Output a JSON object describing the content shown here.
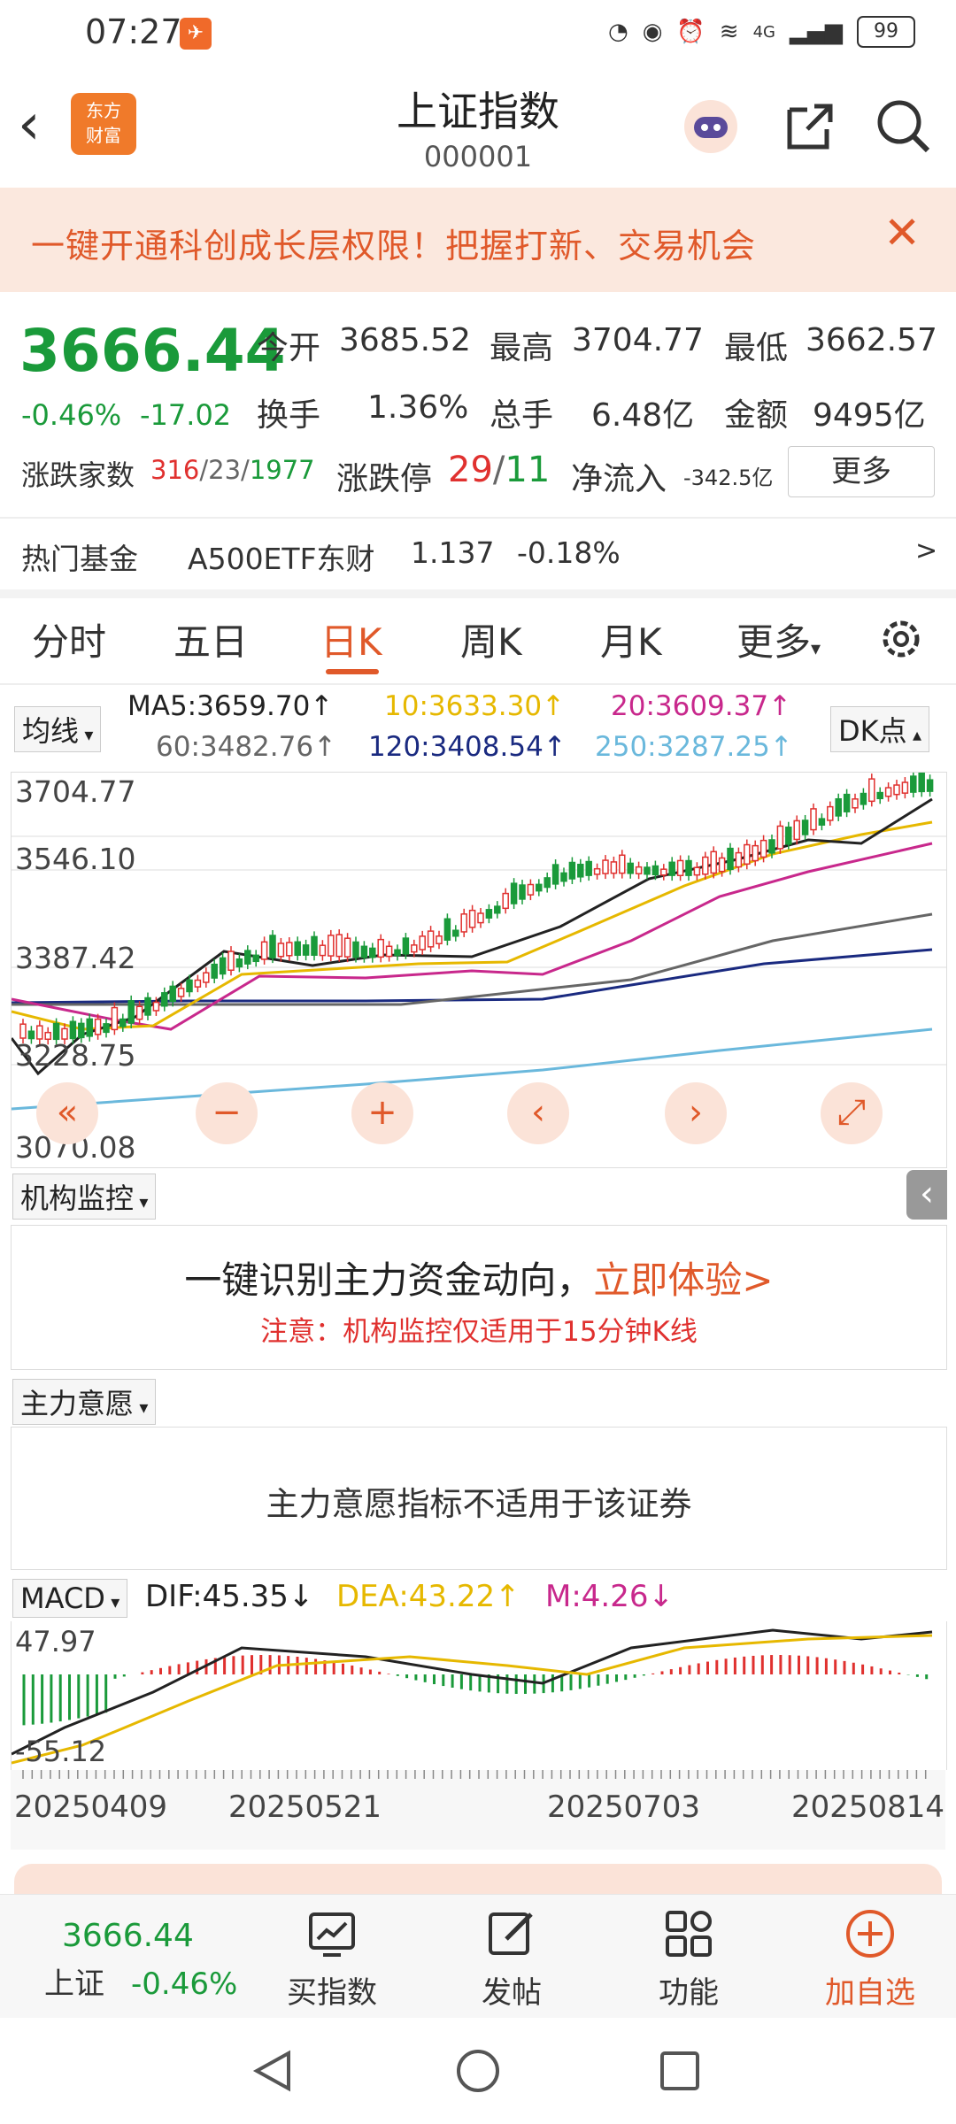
{
  "status": {
    "time": "07:27",
    "network": "4G",
    "battery": "99"
  },
  "header": {
    "title": "上证指数",
    "code": "000001",
    "logo_line1": "东方",
    "logo_line2": "财富"
  },
  "banner": {
    "text": "一键开通科创成长层权限！把握打新、交易机会"
  },
  "quote": {
    "price": "3666.44",
    "change_pct": "-0.46%",
    "change": "-17.02",
    "open_label": "今开",
    "open": "3685.52",
    "high_label": "最高",
    "high": "3704.77",
    "low_label": "最低",
    "low": "3662.57",
    "turnover_label": "换手",
    "turnover": "1.36%",
    "volume_label": "总手",
    "volume": "6.48亿",
    "amount_label": "金额",
    "amount": "9495亿",
    "breadth_label": "涨跌家数",
    "breadth_up": "316",
    "breadth_flat": "23",
    "breadth_down": "1977",
    "limit_label": "涨跌停",
    "limit_up": "29",
    "limit_down": "11",
    "inflow_label": "净流入",
    "inflow": "-342.5亿",
    "more": "更多"
  },
  "fund": {
    "label": "热门基金",
    "name": "A500ETF东财",
    "price": "1.137",
    "chg": "-0.18%",
    "arrow": ">"
  },
  "tabs": [
    "分时",
    "五日",
    "日K",
    "周K",
    "月K",
    "更多"
  ],
  "active_tab": 2,
  "ma": {
    "selector": "均线",
    "dk": "DK点",
    "ma5": "MA5:3659.70↑",
    "ma10": "10:3633.30↑",
    "ma20": "20:3609.37↑",
    "ma60": "60:3482.76↑",
    "ma120": "120:3408.54↑",
    "ma250": "250:3287.25↑",
    "colors": {
      "ma5": "#222222",
      "ma10": "#e6b800",
      "ma20": "#c8288c",
      "ma60": "#666666",
      "ma120": "#1a2a80",
      "ma250": "#6ab8dc"
    }
  },
  "kline_axis": [
    "3704.77",
    "3546.10",
    "3387.42",
    "3228.75",
    "3070.08"
  ],
  "inst": {
    "selector": "机构监控",
    "line1a": "一键识别主力资金动向，",
    "line1b": "立即体验>",
    "note": "注意：机构监控仅适用于15分钟K线"
  },
  "intent": {
    "selector": "主力意愿",
    "text": "主力意愿指标不适用于该证券"
  },
  "macd": {
    "selector": "MACD",
    "dif": "DIF:45.35↓",
    "dea": "DEA:43.22↑",
    "m": "M:4.26↓",
    "axis_top": "47.97",
    "axis_bottom": "-55.12"
  },
  "dates": [
    "20250409",
    "20250521",
    "20250703",
    "20250814"
  ],
  "bottom": {
    "index_price": "3666.44",
    "index_name": "上证",
    "index_chg": "-0.46%",
    "buy": "买指数",
    "post": "发帖",
    "func": "功能",
    "add": "加自选"
  }
}
